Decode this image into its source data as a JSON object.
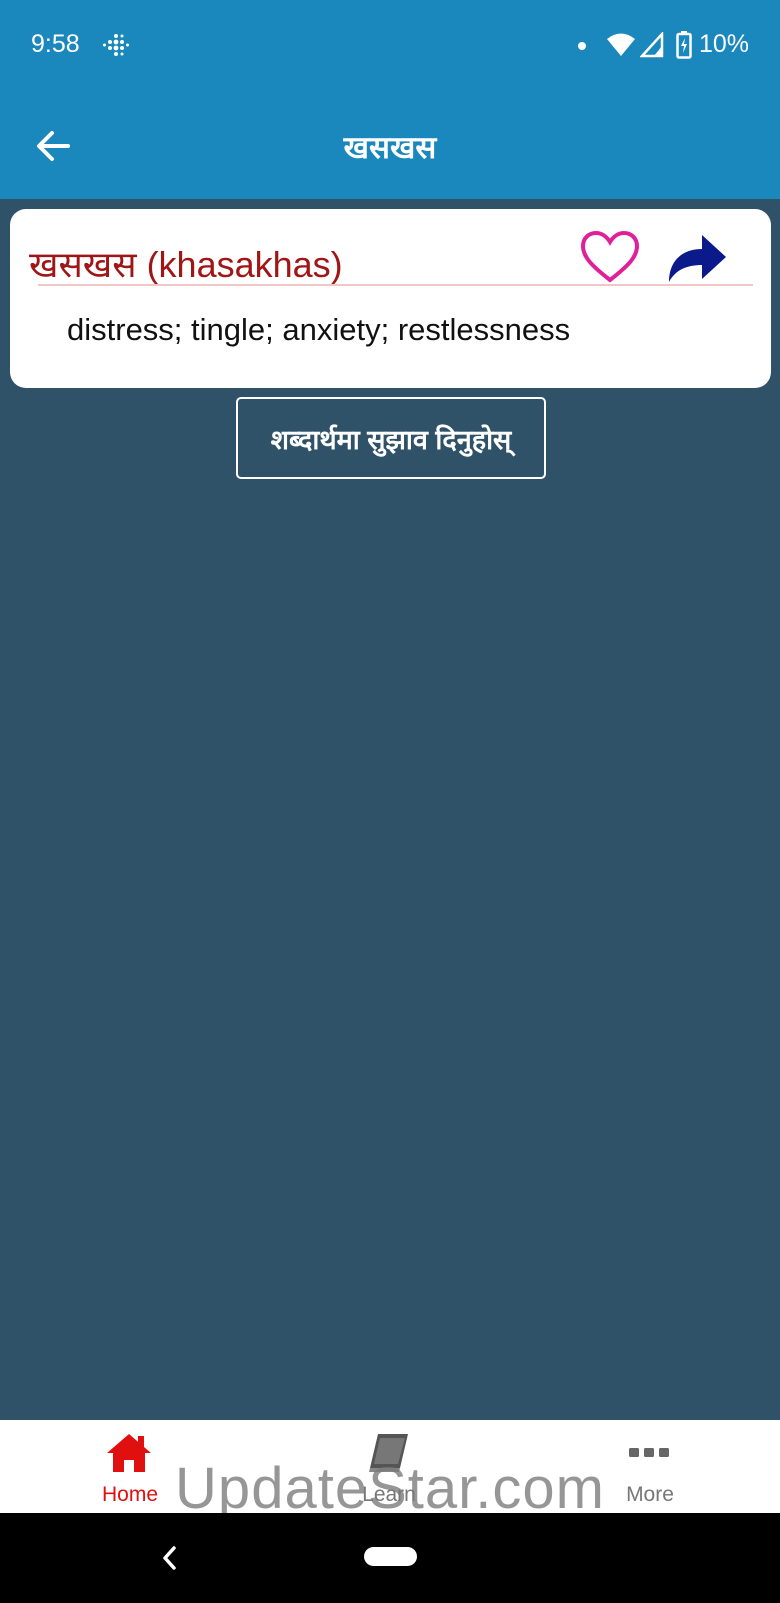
{
  "status_bar": {
    "time": "9:58",
    "battery": "10%",
    "icons": [
      "fitbit-icon",
      "dot-icon",
      "wifi-icon",
      "signal-icon",
      "battery-icon"
    ]
  },
  "app_bar": {
    "title": "खसखस",
    "back_icon": "arrow-left-icon"
  },
  "entry": {
    "heading": "खसखस (khasakhas)",
    "meaning": "distress; tingle; anxiety; restlessness",
    "heading_color": "#a01515",
    "favorite_icon": "heart-outline-icon",
    "favorite_color": "#e0209a",
    "share_icon": "share-arrow-icon",
    "share_color": "#0a1a8a"
  },
  "suggest_button": {
    "label": "शब्दार्थमा सुझाव दिनुहोस्"
  },
  "bottom_nav": {
    "items": [
      {
        "label": "Home",
        "icon": "home-icon",
        "color": "#e01010"
      },
      {
        "label": "Learn",
        "icon": "book-icon",
        "color": "#777777"
      },
      {
        "label": "More",
        "icon": "more-dots-icon",
        "color": "#777777"
      }
    ]
  },
  "watermark": "UpdateStar.com",
  "colors": {
    "primary": "#1a87bd",
    "background": "#2f5268"
  }
}
